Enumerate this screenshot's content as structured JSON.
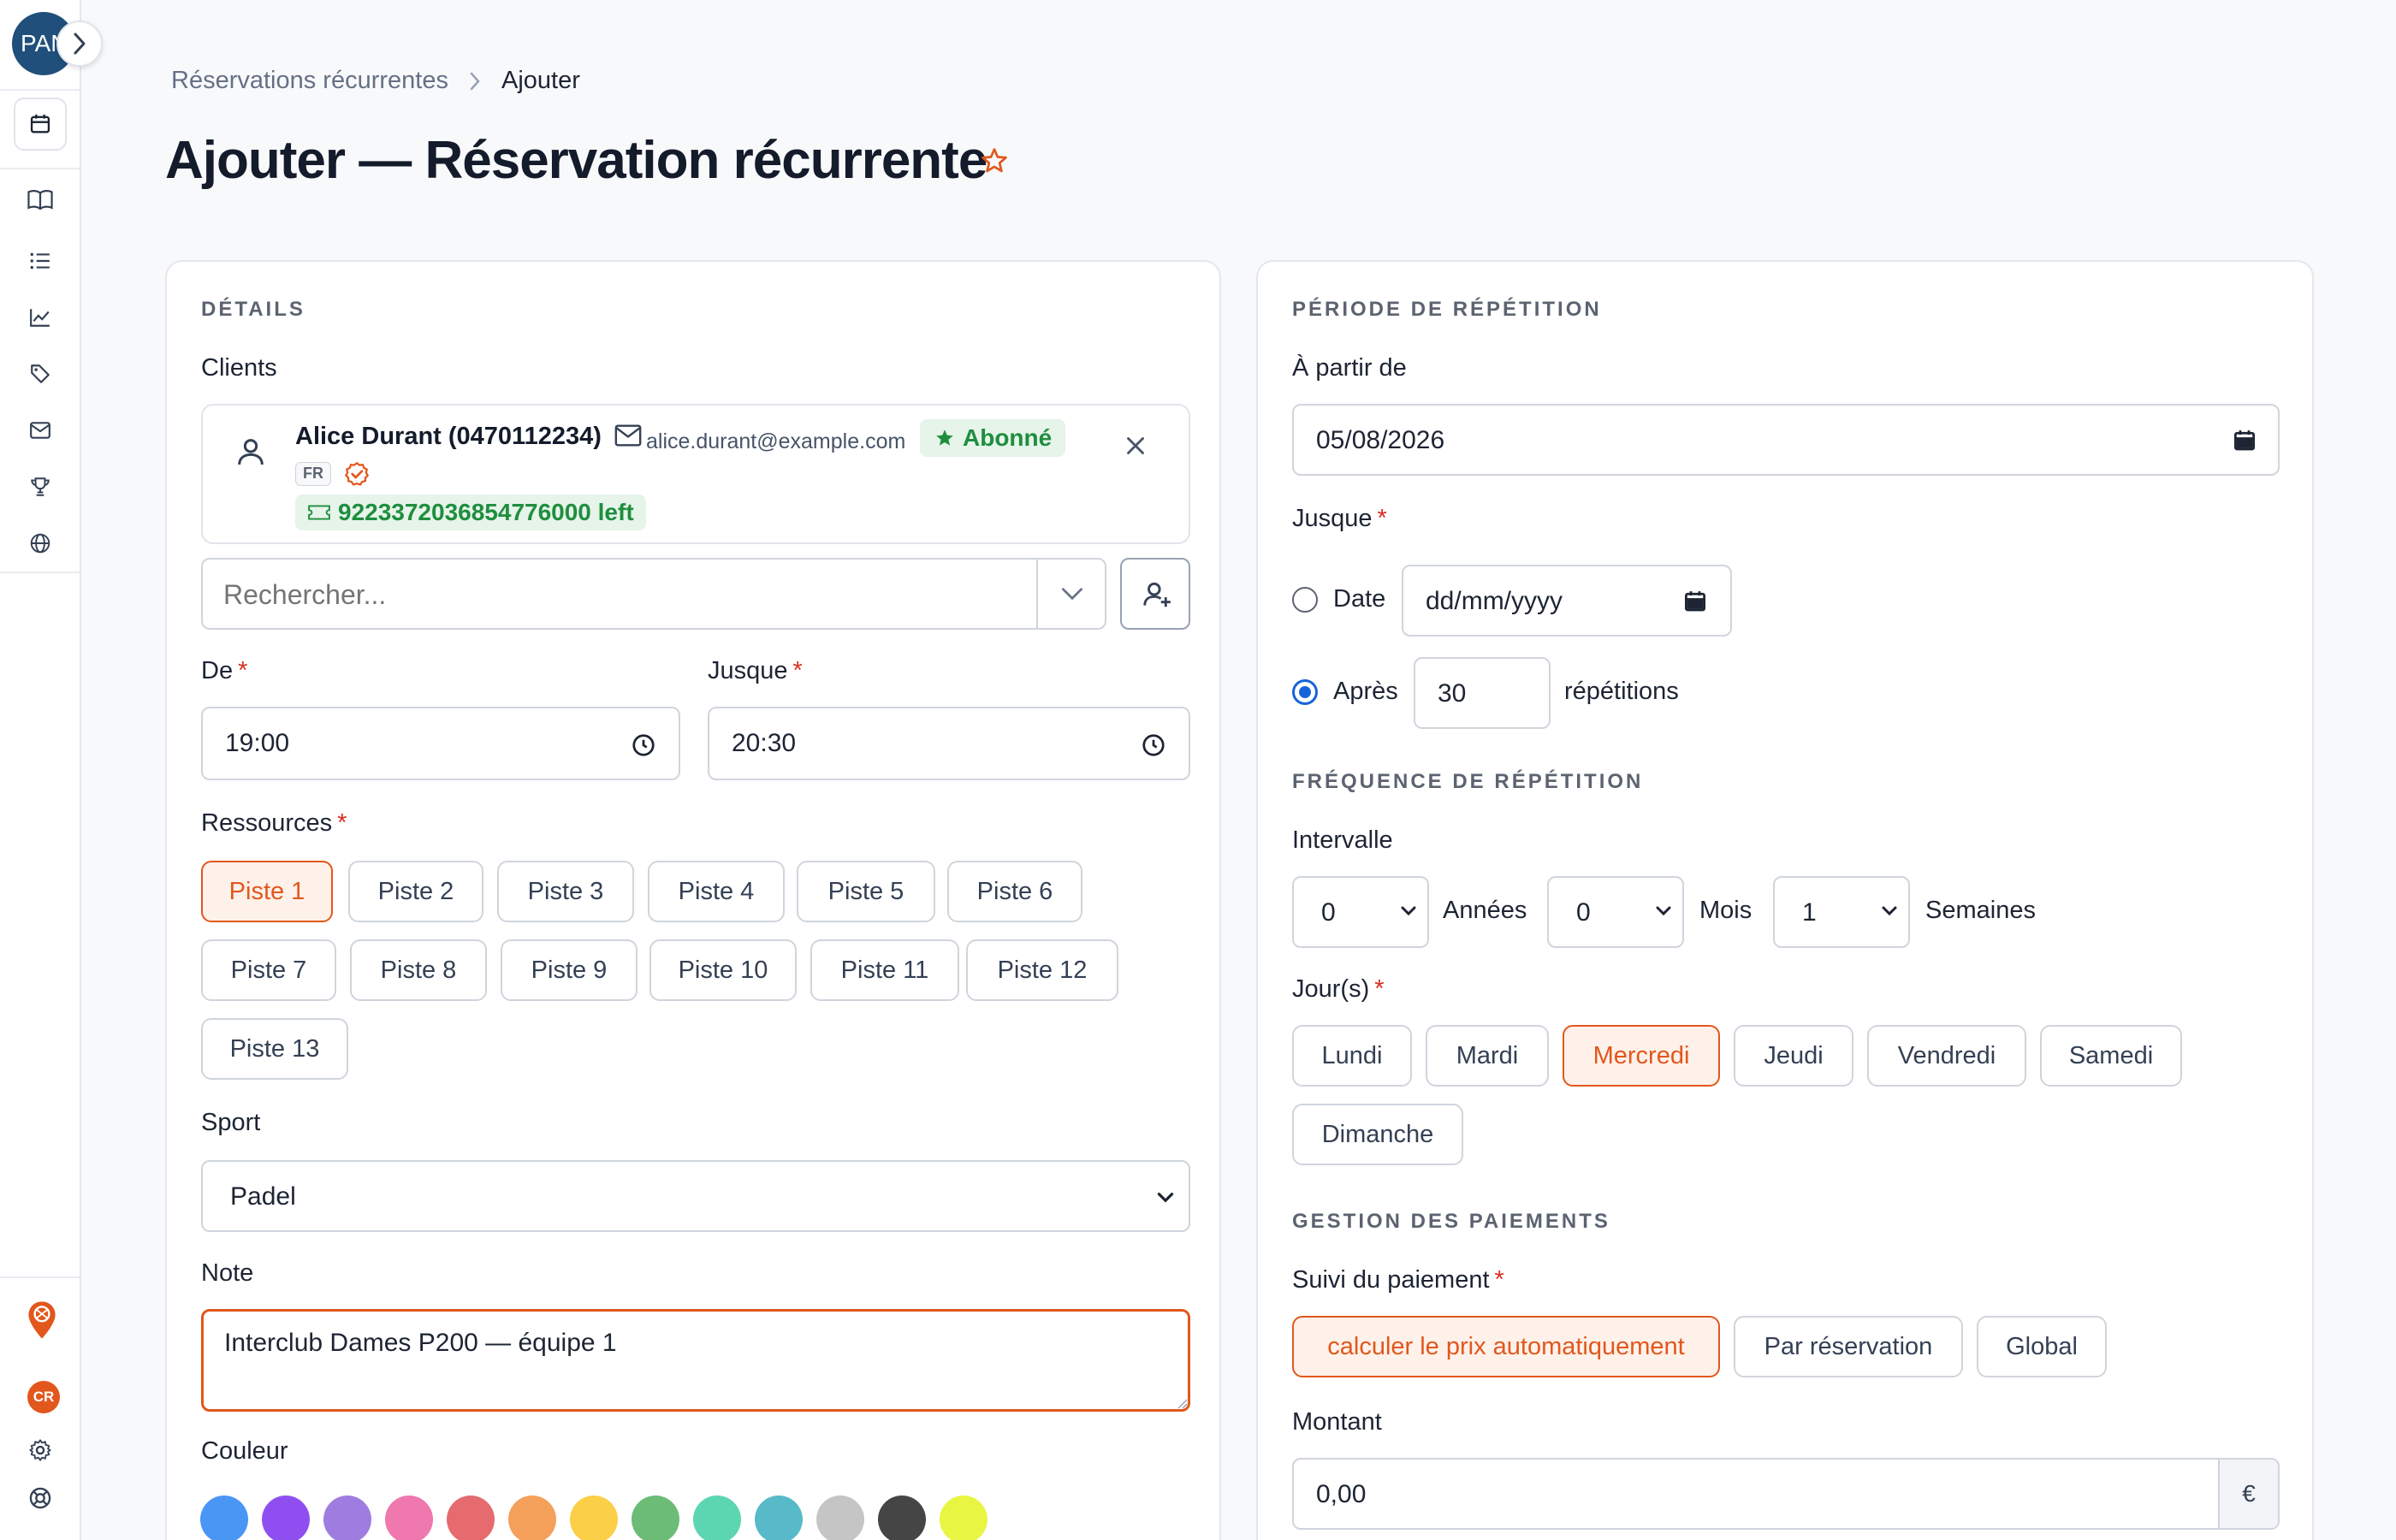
{
  "sidebar": {
    "avatar_text": "PAN",
    "items": [
      {
        "icon": "calendar-icon"
      },
      {
        "icon": "book-icon"
      },
      {
        "icon": "list-icon"
      },
      {
        "icon": "chart-icon"
      },
      {
        "icon": "tag-icon"
      },
      {
        "icon": "mail-icon"
      },
      {
        "icon": "trophy-icon"
      },
      {
        "icon": "globe-icon"
      }
    ],
    "user_initials": "CR"
  },
  "breadcrumb": {
    "parent": "Réservations récurrentes",
    "current": "Ajouter"
  },
  "page_title": "Ajouter — Réservation récurrente",
  "details": {
    "section_title": "DÉTAILS",
    "clients_label": "Clients",
    "client": {
      "name": "Alice Durant (0470112234)",
      "email": "alice.durant@example.com",
      "badge": "Abonné",
      "language": "FR",
      "credits": "9223372036854776000 left"
    },
    "search_placeholder": "Rechercher...",
    "from_label": "De",
    "from_value": "19:00",
    "until_label": "Jusque",
    "until_value": "20:30",
    "resources_label": "Ressources",
    "resources": [
      "Piste 1",
      "Piste 2",
      "Piste 3",
      "Piste 4",
      "Piste 5",
      "Piste 6",
      "Piste 7",
      "Piste 8",
      "Piste 9",
      "Piste 10",
      "Piste 11",
      "Piste 12",
      "Piste 13"
    ],
    "selected_resource": "Piste 1",
    "sport_label": "Sport",
    "sport_value": "Padel",
    "note_label": "Note",
    "note_value": "Interclub Dames P200 — équipe 1",
    "color_label": "Couleur",
    "colors": [
      "#4a96f5",
      "#8f4ff0",
      "#9f7de0",
      "#ef78ae",
      "#e56b6f",
      "#f5a05a",
      "#fccf48",
      "#6cbc78",
      "#5bd6b0",
      "#58b9c9",
      "#c5c5c5",
      "#454545",
      "#e8f542"
    ]
  },
  "period": {
    "section_title": "PÉRIODE DE RÉPÉTITION",
    "from_label": "À partir de",
    "from_value": "05/08/2026",
    "until_label": "Jusque",
    "date_option": "Date",
    "date_placeholder": "dd/mm/yyyy",
    "after_option": "Après",
    "after_value": "30",
    "repetitions_label": "répétitions"
  },
  "frequency": {
    "section_title": "FRÉQUENCE DE RÉPÉTITION",
    "interval_label": "Intervalle",
    "years_value": "0",
    "years_label": "Années",
    "months_value": "0",
    "months_label": "Mois",
    "weeks_value": "1",
    "weeks_label": "Semaines",
    "days_label": "Jour(s)",
    "days": [
      "Lundi",
      "Mardi",
      "Mercredi",
      "Jeudi",
      "Vendredi",
      "Samedi",
      "Dimanche"
    ],
    "selected_day": "Mercredi"
  },
  "payments": {
    "section_title": "GESTION DES PAIEMENTS",
    "tracking_label": "Suivi du paiement",
    "options": [
      "calculer le prix automatiquement",
      "Par réservation",
      "Global"
    ],
    "selected_option": "calculer le prix automatiquement",
    "amount_label": "Montant",
    "amount_value": "0,00",
    "currency": "€"
  },
  "colors": {
    "accent": "#e2571c",
    "accent_bg": "#fdf1ea",
    "radio_blue": "#1665d8",
    "success": "#1e8e3e"
  }
}
